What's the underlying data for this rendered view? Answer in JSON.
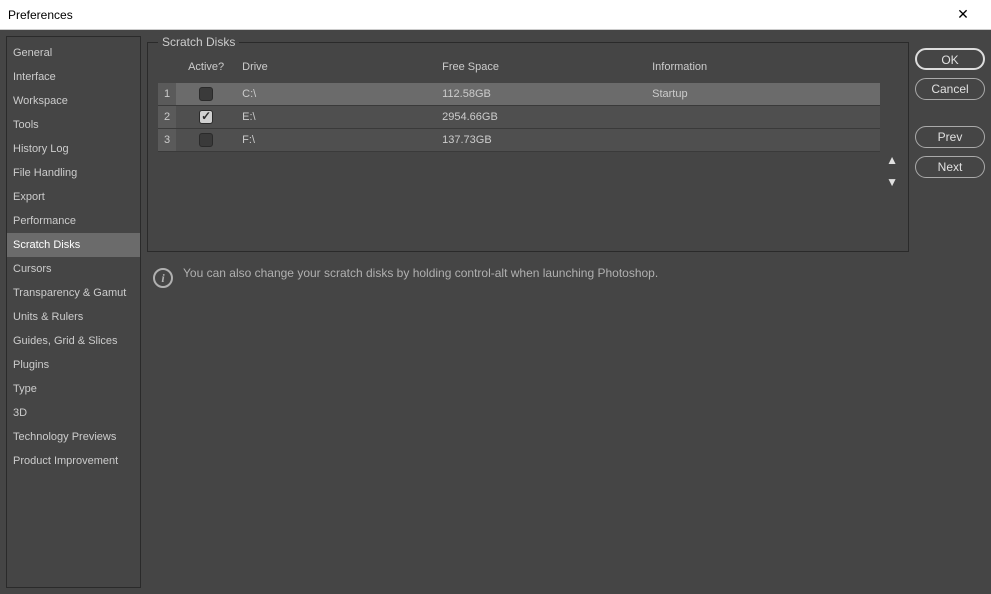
{
  "window": {
    "title": "Preferences"
  },
  "sidebar": {
    "items": [
      "General",
      "Interface",
      "Workspace",
      "Tools",
      "History Log",
      "File Handling",
      "Export",
      "Performance",
      "Scratch Disks",
      "Cursors",
      "Transparency & Gamut",
      "Units & Rulers",
      "Guides, Grid & Slices",
      "Plugins",
      "Type",
      "3D",
      "Technology Previews",
      "Product Improvement"
    ],
    "selectedIndex": 8
  },
  "panel": {
    "title": "Scratch Disks",
    "columns": {
      "active": "Active?",
      "drive": "Drive",
      "freeSpace": "Free Space",
      "information": "Information"
    },
    "rows": [
      {
        "num": "1",
        "active": false,
        "drive": "C:\\",
        "freeSpace": "112.58GB",
        "information": "Startup",
        "selected": true
      },
      {
        "num": "2",
        "active": true,
        "drive": "E:\\",
        "freeSpace": "2954.66GB",
        "information": "",
        "selected": false
      },
      {
        "num": "3",
        "active": false,
        "drive": "F:\\",
        "freeSpace": "137.73GB",
        "information": "",
        "selected": false
      }
    ],
    "hint": "You can also change your scratch disks by holding control-alt when launching Photoshop."
  },
  "buttons": {
    "ok": "OK",
    "cancel": "Cancel",
    "prev": "Prev",
    "next": "Next"
  }
}
